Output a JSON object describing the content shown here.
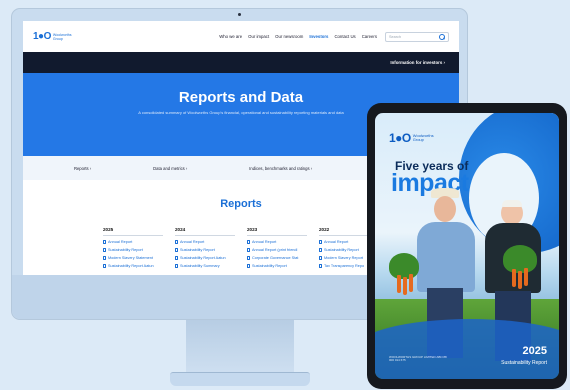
{
  "site": {
    "logo_mark": "1●O",
    "logo_text": "Woolworths Group",
    "nav": [
      "Who we are",
      "Our impact",
      "Our newsroom",
      "Investors",
      "Contact Us",
      "Careers"
    ],
    "nav_active_index": 3,
    "search_placeholder": "Search",
    "investor_link": "Information for investors  ›",
    "hero_title": "Reports and Data",
    "hero_subtitle": "A consolidated summary of Woolworths Group's financial, operational and sustainability reporting materials and data",
    "subnav": [
      "Reports  ›",
      "Data and metrics  ›",
      "Indices, benchmarks and ratings  ›",
      "More information  ›"
    ],
    "reports_title": "Reports",
    "years": [
      {
        "year": "2025",
        "items": [
          "Annual Report",
          "Sustainability Report",
          "Modern Slavery Statement",
          "Sustainability Report Aatun"
        ]
      },
      {
        "year": "2024",
        "items": [
          "Annual Report",
          "Sustainability Report",
          "Sustainability Report Aatun",
          "Sustainability Summary"
        ]
      },
      {
        "year": "2023",
        "items": [
          "Annual Report",
          "Annual Report (print friendl",
          "Corporate Governance Stat",
          "Sustainability Report"
        ]
      },
      {
        "year": "2022",
        "items": [
          "Annual Report",
          "Sustainability Report",
          "Modern Slavery Report",
          "Tax Transparency Repo"
        ]
      }
    ]
  },
  "tablet": {
    "logo_mark": "1●O",
    "logo_text": "Woolworths Group",
    "title_line1": "Five years of",
    "title_line2": "impact",
    "year": "2025",
    "report_label": "Sustainability Report",
    "footnote": "WOOLWORTHS GROUP LIMITED ABN 88 000 014 675"
  },
  "colors": {
    "brand_blue": "#1a6fd6",
    "hero_blue": "#2478e6",
    "dark_bar": "#111a2e"
  }
}
